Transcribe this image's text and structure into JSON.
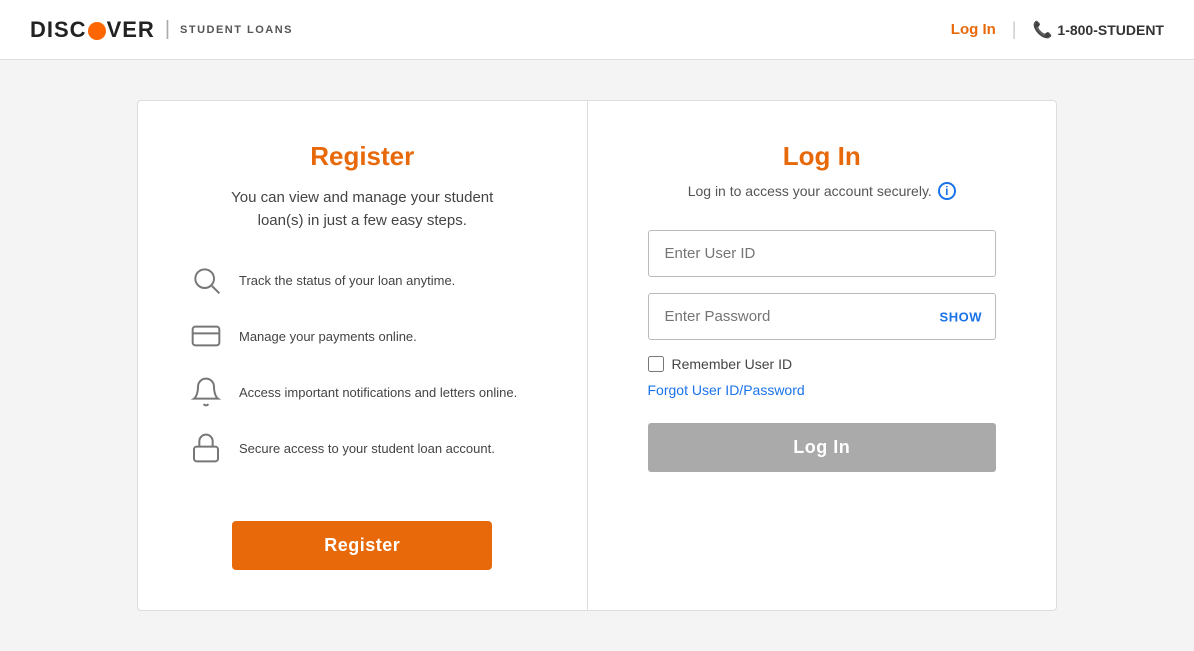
{
  "header": {
    "logo_text": "DISC VER",
    "logo_brand": "DISCOVER",
    "logo_subtitle": "STUDENT LOANS",
    "login_link": "Log In",
    "phone_number": "1-800-STUDENT"
  },
  "register": {
    "title": "Register",
    "subtitle": "You can view and manage your student loan(s) in just a few easy steps.",
    "features": [
      {
        "icon": "search-icon",
        "text": "Track the status of your loan anytime."
      },
      {
        "icon": "payment-icon",
        "text": "Manage your payments online."
      },
      {
        "icon": "bell-icon",
        "text": "Access important notifications and letters online."
      },
      {
        "icon": "lock-icon",
        "text": "Secure access to your student loan account."
      }
    ],
    "button_label": "Register"
  },
  "login": {
    "title": "Log In",
    "subtitle": "Log in to access your account securely.",
    "user_id_placeholder": "Enter User ID",
    "password_placeholder": "Enter Password",
    "show_label": "SHOW",
    "remember_label": "Remember User ID",
    "forgot_label": "Forgot User ID/Password",
    "button_label": "Log In"
  }
}
